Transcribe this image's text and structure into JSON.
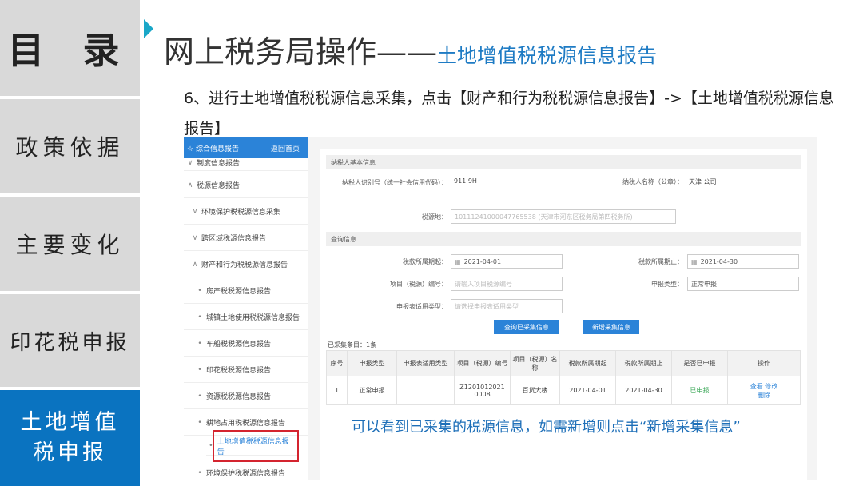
{
  "toc": {
    "title": "目 录",
    "items": [
      "政策依据",
      "主要变化",
      "印花税申报",
      "土地增值税申报"
    ]
  },
  "header": {
    "title": "网上税务局操作——",
    "subtitle": "土地增值税税源信息报告",
    "step": "6、进行土地增值税税源信息采集，点击【财产和行为税税源信息报告】->【土地增值税税源信息报告】"
  },
  "nav": {
    "header_label": "综合信息报告",
    "back_label": "返回首页",
    "items": [
      {
        "mark": "∨",
        "label": "制度信息报告"
      },
      {
        "mark": "∧",
        "label": "税源信息报告"
      },
      {
        "mark": "∨",
        "label": "环境保护税税源信息采集"
      },
      {
        "mark": "∨",
        "label": "跨区域税源信息报告"
      },
      {
        "mark": "∧",
        "label": "财产和行为税税源信息报告"
      },
      {
        "mark": "•",
        "label": "房产税税源信息报告"
      },
      {
        "mark": "•",
        "label": "城镇土地使用税税源信息报告"
      },
      {
        "mark": "•",
        "label": "车船税税源信息报告"
      },
      {
        "mark": "•",
        "label": "印花税税源信息报告"
      },
      {
        "mark": "•",
        "label": "资源税税源信息报告"
      },
      {
        "mark": "•",
        "label": "耕地占用税税源信息报告"
      },
      {
        "mark": "•",
        "label": "土地增值税税源信息报告"
      },
      {
        "mark": "•",
        "label": "环境保护税税源信息报告"
      }
    ]
  },
  "taxpayer": {
    "section": "纳税人基本信息",
    "id_label": "纳税人识别号（统一社会信用代码）：",
    "id_value": "911        9H",
    "name_label": "纳税人名称（公章）：",
    "name_value": "天津              公司",
    "place_label": "税源地：",
    "place_value": "10111241000047765538 (天津市河东区税务局第四税务所)"
  },
  "query": {
    "section": "查询信息",
    "start_label": "税款所属期起：",
    "start_value": "2021-04-01",
    "end_label": "税款所属期止：",
    "end_value": "2021-04-30",
    "item_label": "项目（税源）编号：",
    "item_placeholder": "请输入项目税源编号",
    "type_label": "申报类型：",
    "type_value": "正常申报",
    "form_label": "申报表适用类型：",
    "form_placeholder": "请选择申报表适用类型",
    "query_button": "查询已采集信息",
    "add_button": "新增采集信息"
  },
  "results": {
    "count_label": "已采集条目：1条",
    "headers": [
      "序号",
      "申报类型",
      "申报表适用类型",
      "项目（税源）编号",
      "项目（税源）名称",
      "税款所属期起",
      "税款所属期止",
      "是否已申报",
      "操作"
    ],
    "row": {
      "index": "1",
      "type": "正常申报",
      "form": "",
      "code": "Z1201012021 0008",
      "name": "百货大楼",
      "start": "2021-04-01",
      "end": "2021-04-30",
      "declared": "已申报",
      "view": "查看",
      "edit": "修改",
      "delete": "删除"
    }
  },
  "note": "可以看到已采集的税源信息，如需新增则点击“新增采集信息”"
}
